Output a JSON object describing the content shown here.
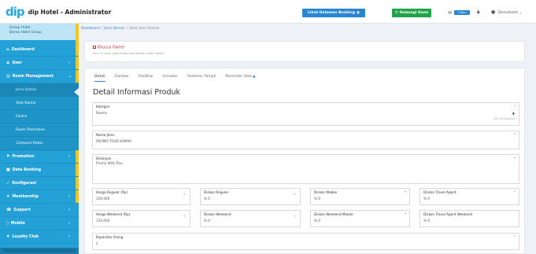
{
  "app": {
    "logo_text": "dip",
    "title": "dip Hotel - Administrator"
  },
  "topbar": {
    "view_booking_label": "Lihat Halaman Booking",
    "view_booking_icon": "globe-icon",
    "contact_label": "Hubungi Kami",
    "contact_icon": "phone-icon",
    "mail_icon": "mail-icon",
    "mail_badge": "1 Baru",
    "user_icon": "user-icon",
    "chat_icon": "chat-icon",
    "user_label": "Demohotel"
  },
  "sidebar": {
    "group_line1": "Group Hotel:",
    "group_line2": "Demo Hotel Group",
    "items": [
      {
        "label": "Dashboard",
        "icon": "home-icon",
        "chevron": ""
      },
      {
        "label": "User",
        "icon": "user-icon",
        "chevron": "›"
      },
      {
        "label": "Room Management",
        "icon": "list-icon",
        "chevron": "⌄"
      },
      {
        "label": "Promotion",
        "icon": "tag-icon",
        "chevron": "›"
      },
      {
        "label": "Data Booking",
        "icon": "book-icon",
        "chevron": ""
      },
      {
        "label": "Konfigurasi",
        "icon": "wrench-icon",
        "chevron": ""
      },
      {
        "label": "Membership",
        "icon": "star-icon",
        "chevron": "›"
      },
      {
        "label": "Support",
        "icon": "support-icon",
        "chevron": "›"
      },
      {
        "label": "Mobile",
        "icon": "mobile-icon",
        "chevron": "›"
      },
      {
        "label": "Loyalty Club",
        "icon": "loyalty-icon",
        "chevron": "›"
      }
    ],
    "sub_items": [
      {
        "label": "Jenis Kamar",
        "active": true
      },
      {
        "label": "Stok Kamar",
        "active": false
      },
      {
        "label": "Ekstra",
        "active": false
      },
      {
        "label": "Room Promotion",
        "active": false
      },
      {
        "label": "Compare Rates",
        "active": false
      }
    ]
  },
  "breadcrumb": {
    "items": [
      "Dashboard",
      "Jenis Kamar",
      "Ubah Jenis Kamar"
    ],
    "separator": "/"
  },
  "owner_card": {
    "title": "Khusus Owner",
    "description": "Fitur ini akan aktif ketika Jenis Kamar sudah dipilih"
  },
  "tabs": [
    {
      "label": "Detail",
      "active": true
    },
    {
      "label": "Gambar",
      "active": false
    },
    {
      "label": "Fasilitas",
      "active": false
    },
    {
      "label": "Includes",
      "active": false
    },
    {
      "label": "Halaman Tampil",
      "active": false
    },
    {
      "label": "Reminder Stok",
      "active": false,
      "warn_icon": "warning-icon"
    }
  ],
  "form": {
    "title": "Detail Informasi Produk",
    "required_mark": "*",
    "kategori": {
      "label": "Kategori",
      "value": "Rooms",
      "hint": "Edit list Kategori"
    },
    "nama_jenis": {
      "label": "Nama Jenis",
      "value": "PROMO TOUR KAMAR"
    },
    "deskripsi": {
      "label": "Deskripsi",
      "value": "Promo With Tour"
    },
    "row1": [
      {
        "label": "Harga Reguler (Rp)",
        "value": "150,000"
      },
      {
        "label": "Diskon Reguler",
        "value": "% 0"
      },
      {
        "label": "Diskon Mobile",
        "value": "% 0"
      },
      {
        "label": "Diskon Travel Agent",
        "value": "% 0"
      }
    ],
    "row2": [
      {
        "label": "Harga Weekend (Rp)",
        "value": "120,000"
      },
      {
        "label": "Diskon Weekend",
        "value": "% 0"
      },
      {
        "label": "Diskon Weekend Mobile",
        "value": "% 0"
      },
      {
        "label": "Diskon Travel Agent Weekend",
        "value": "% 0"
      }
    ],
    "kapasitas": {
      "label": "Kapasitas Orang",
      "value": "2"
    }
  }
}
